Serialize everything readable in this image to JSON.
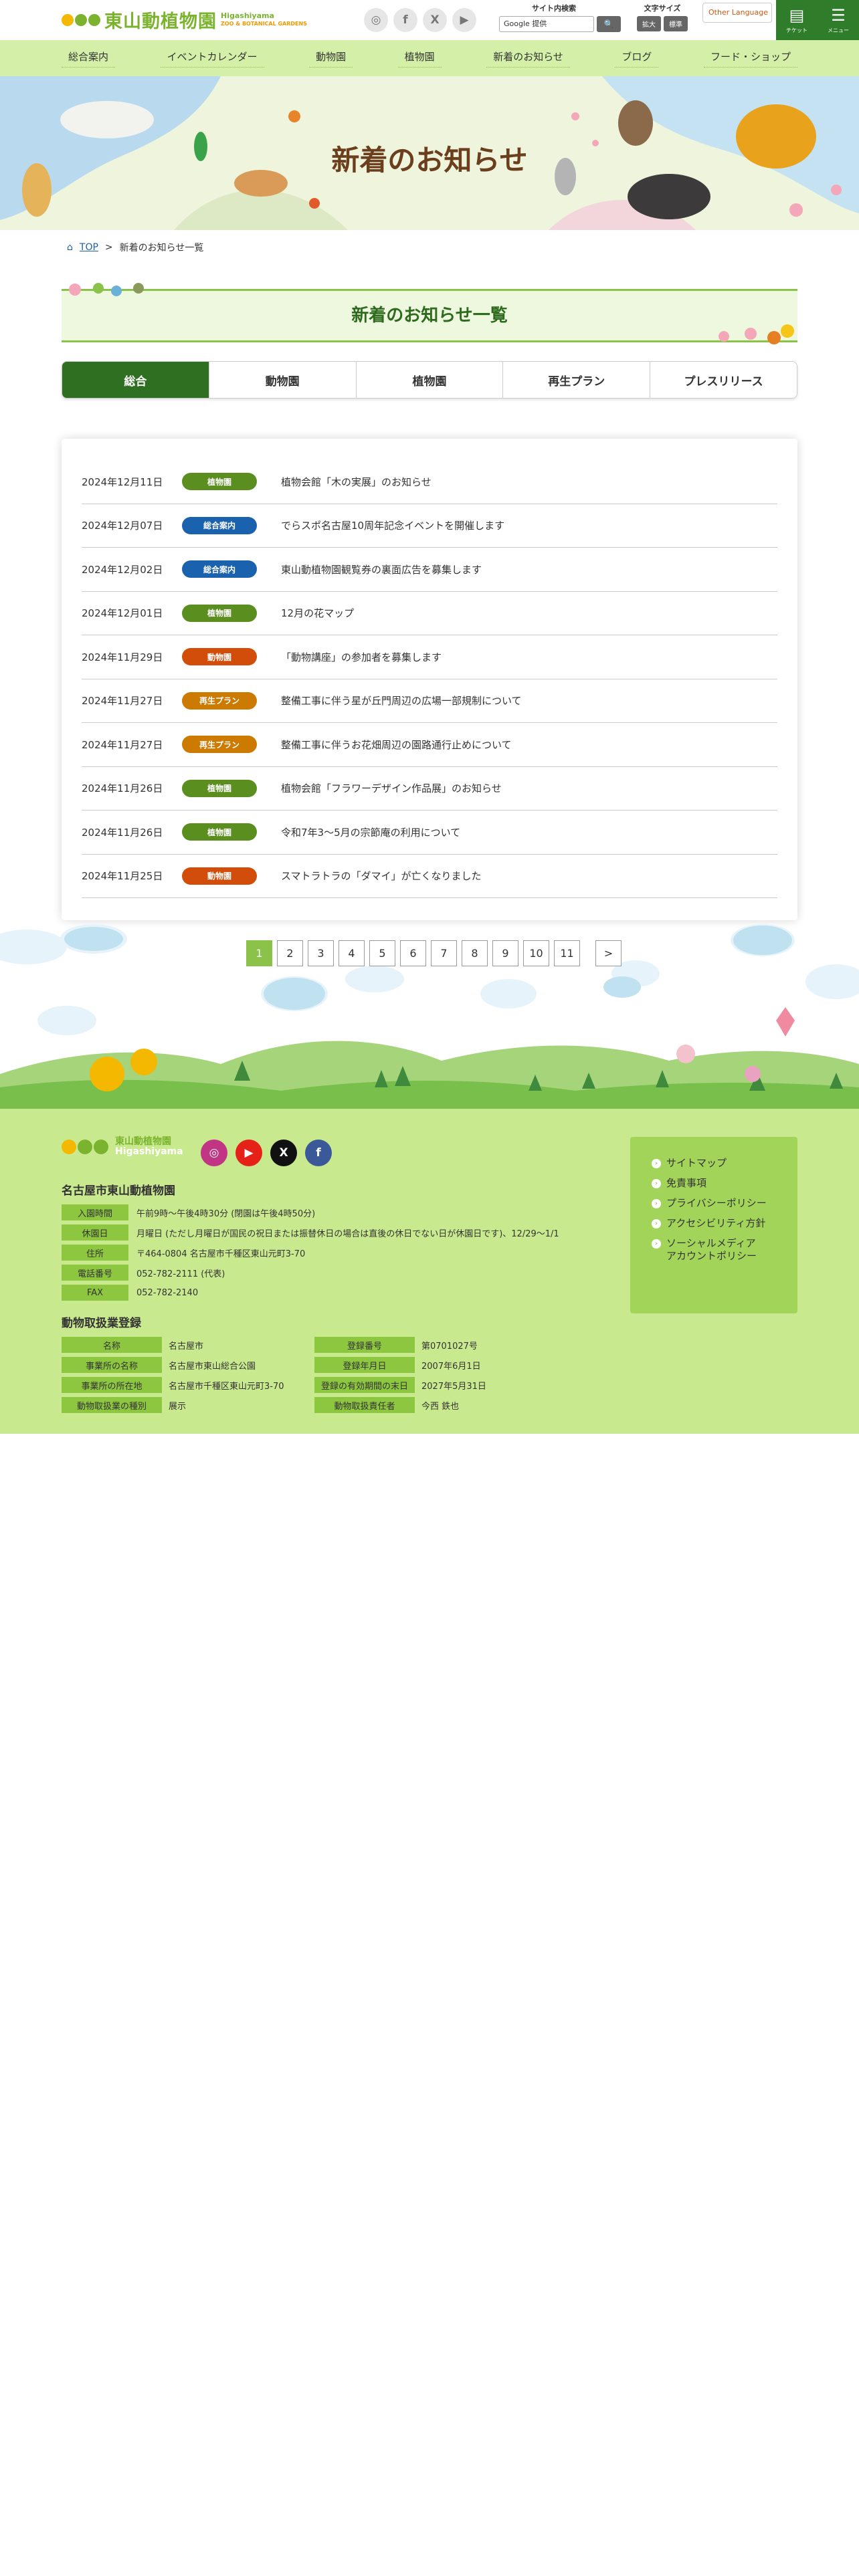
{
  "header": {
    "logo_title": "東山動植物園",
    "logo_en_1": "Higashiyama",
    "logo_en_2": "ZOO & BOTANICAL GARDENS",
    "social": [
      "instagram-icon",
      "facebook-icon",
      "x-icon",
      "youtube-icon"
    ],
    "search_label": "サイト内検索",
    "search_placeholder": "Google 提供",
    "fontsize_label": "文字サイズ",
    "fontsize_large": "拡大",
    "fontsize_normal": "標準",
    "language": "Other Language",
    "ticket_label": "チケット",
    "menu_label": "メニュー"
  },
  "nav": [
    "総合案内",
    "イベントカレンダー",
    "動物園",
    "植物園",
    "新着のお知らせ",
    "ブログ",
    "フード・ショップ"
  ],
  "hero": {
    "title": "新着のお知らせ"
  },
  "breadcrumb": {
    "home": "TOP",
    "current": "新着のお知らせ一覧"
  },
  "section": {
    "title": "新着のお知らせ一覧"
  },
  "tabs": [
    "総合",
    "動物園",
    "植物園",
    "再生プラン",
    "プレスリリース"
  ],
  "news": [
    {
      "date": "2024年12月11日",
      "category": "植物園",
      "title": "植物会館「木の実展」のお知らせ"
    },
    {
      "date": "2024年12月07日",
      "category": "総合案内",
      "title": "でらスポ名古屋10周年記念イベントを開催します"
    },
    {
      "date": "2024年12月02日",
      "category": "総合案内",
      "title": "東山動植物園観覧券の裏面広告を募集します"
    },
    {
      "date": "2024年12月01日",
      "category": "植物園",
      "title": "12月の花マップ"
    },
    {
      "date": "2024年11月29日",
      "category": "動物園",
      "title": "「動物講座」の参加者を募集します"
    },
    {
      "date": "2024年11月27日",
      "category": "再生プラン",
      "title": "整備工事に伴う星が丘門周辺の広場一部規制について"
    },
    {
      "date": "2024年11月27日",
      "category": "再生プラン",
      "title": "整備工事に伴うお花畑周辺の園路通行止めについて"
    },
    {
      "date": "2024年11月26日",
      "category": "植物園",
      "title": "植物会館「フラワーデザイン作品展」のお知らせ"
    },
    {
      "date": "2024年11月26日",
      "category": "植物園",
      "title": "令和7年3～5月の宗節庵の利用について"
    },
    {
      "date": "2024年11月25日",
      "category": "動物園",
      "title": "スマトラトラの「ダマイ」が亡くなりました"
    }
  ],
  "category_colors": {
    "植物園": "#5a8f1f",
    "総合案内": "#1a62ae",
    "動物園": "#d24c0a",
    "再生プラン": "#cc7a00"
  },
  "pager": {
    "pages": [
      "1",
      "2",
      "3",
      "4",
      "5",
      "6",
      "7",
      "8",
      "9",
      "10",
      "11"
    ],
    "current": "1",
    "next": ">"
  },
  "footer": {
    "org_name": "名古屋市東山動植物園",
    "info": [
      {
        "key": "入園時間",
        "value": "午前9時～午後4時30分 (閉園は午後4時50分)"
      },
      {
        "key": "休園日",
        "value": "月曜日 (ただし月曜日が国民の祝日または振替休日の場合は直後の休日でない日が休園日です)、12/29～1/1"
      },
      {
        "key": "住所",
        "value": "〒464-0804 名古屋市千種区東山元町3-70"
      },
      {
        "key": "電話番号",
        "value": "052-782-2111 (代表)"
      },
      {
        "key": "FAX",
        "value": "052-782-2140"
      }
    ],
    "reg_title": "動物取扱業登録",
    "reg": [
      {
        "k1": "名称",
        "v1": "名古屋市",
        "k2": "登録番号",
        "v2": "第0701027号"
      },
      {
        "k1": "事業所の名称",
        "v1": "名古屋市東山総合公園",
        "k2": "登録年月日",
        "v2": "2007年6月1日"
      },
      {
        "k1": "事業所の所在地",
        "v1": "名古屋市千種区東山元町3-70",
        "k2": "登録の有効期間の末日",
        "v2": "2027年5月31日"
      },
      {
        "k1": "動物取扱業の種別",
        "v1": "展示",
        "k2": "動物取扱責任者",
        "v2": "今西 鉄也"
      }
    ],
    "links": [
      "サイトマップ",
      "免責事項",
      "プライバシーポリシー",
      "アクセシビリティ方針",
      "ソーシャルメディア\nアカウントポリシー"
    ]
  }
}
